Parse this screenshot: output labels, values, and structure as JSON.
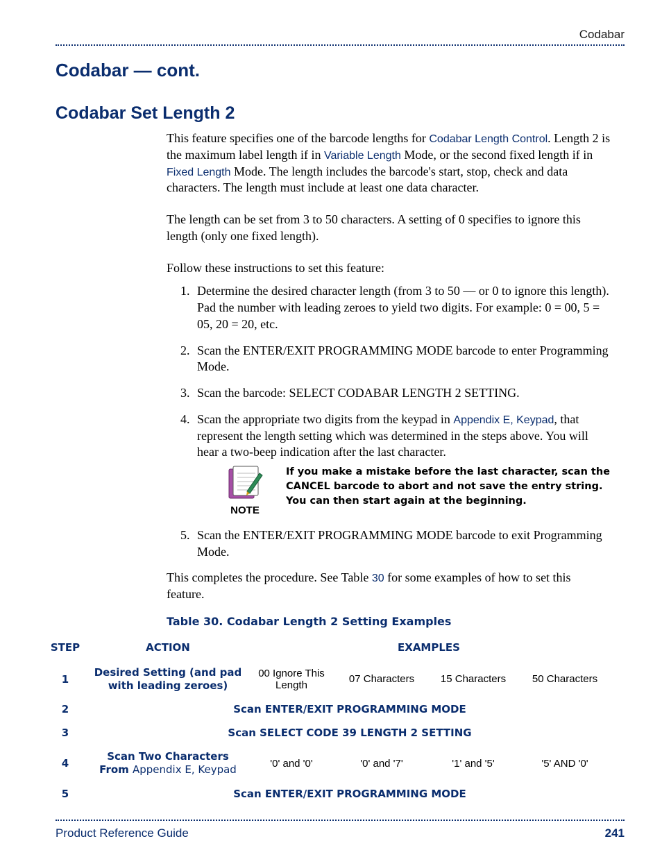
{
  "header": {
    "running": "Codabar"
  },
  "titles": {
    "cont": "Codabar — cont.",
    "section": "Codabar Set Length 2"
  },
  "intro": {
    "p1a": "This feature specifies one of the barcode lengths for ",
    "link1": "Codabar Length Control",
    "p1b": ". Length 2 is the maximum label length if in ",
    "link2": "Variable Length",
    "p1c": " Mode, or the second fixed length if in ",
    "link3": "Fixed Length",
    "p1d": " Mode. The length includes the barcode's start, stop, check and data characters. The length must include at least one data character.",
    "p2": "The length can be set from 3 to 50 characters. A setting of 0 specifies to ignore this length (only one fixed length).",
    "p3": "Follow these instructions to set this feature:"
  },
  "steps": {
    "s1": "Determine the desired character length (from 3 to 50 — or 0 to ignore this length). Pad the number with leading zeroes to yield two digits. For example: 0 = 00, 5 = 05, 20 = 20, etc.",
    "s2": "Scan the ENTER/EXIT PROGRAMMING MODE barcode to enter Programming Mode.",
    "s3": "Scan the barcode: SELECT CODABAR LENGTH 2 SETTING.",
    "s4a": "Scan the appropriate two digits from the keypad in ",
    "s4link": "Appendix E, Keypad",
    "s4b": ", that represent the length setting which was determined in the steps above. You will hear a two-beep indica­tion after the last character.",
    "s5": "Scan the ENTER/EXIT PROGRAMMING MODE barcode to exit Programming Mode."
  },
  "note": {
    "label": "NOTE",
    "text": "If you make a mistake before the last character, scan the CANCEL barcode to abort and not save the entry string. You can then start again at the beginning."
  },
  "closing": {
    "a": "This completes the procedure. See Table ",
    "tnum": "30",
    "b": " for some examples of how to set this feature."
  },
  "table": {
    "caption": "Table 30. Codabar Length 2 Setting Examples",
    "head_step": "STEP",
    "head_action": "ACTION",
    "head_examples": "EXAMPLES",
    "r1": {
      "step": "1",
      "action": "Desired Setting (and pad with leading zeroes)",
      "c1": "00 Ignore This Length",
      "c2": "07 Characters",
      "c3": "15 Characters",
      "c4": "50 Characters"
    },
    "r2": {
      "step": "2",
      "span": "Scan ENTER/EXIT PROGRAMMING MODE"
    },
    "r3": {
      "step": "3",
      "span": "Scan SELECT CODE 39 LENGTH 2 SETTING"
    },
    "r4": {
      "step": "4",
      "action_a": "Scan Two Characters From ",
      "action_link": "Appendix E, Keypad",
      "c1": "'0' and '0'",
      "c2": "'0' and '7'",
      "c3": "'1' and '5'",
      "c4": "'5' AND '0'"
    },
    "r5": {
      "step": "5",
      "span": "Scan ENTER/EXIT PROGRAMMING MODE"
    }
  },
  "footer": {
    "guide": "Product Reference Guide",
    "page": "241"
  }
}
